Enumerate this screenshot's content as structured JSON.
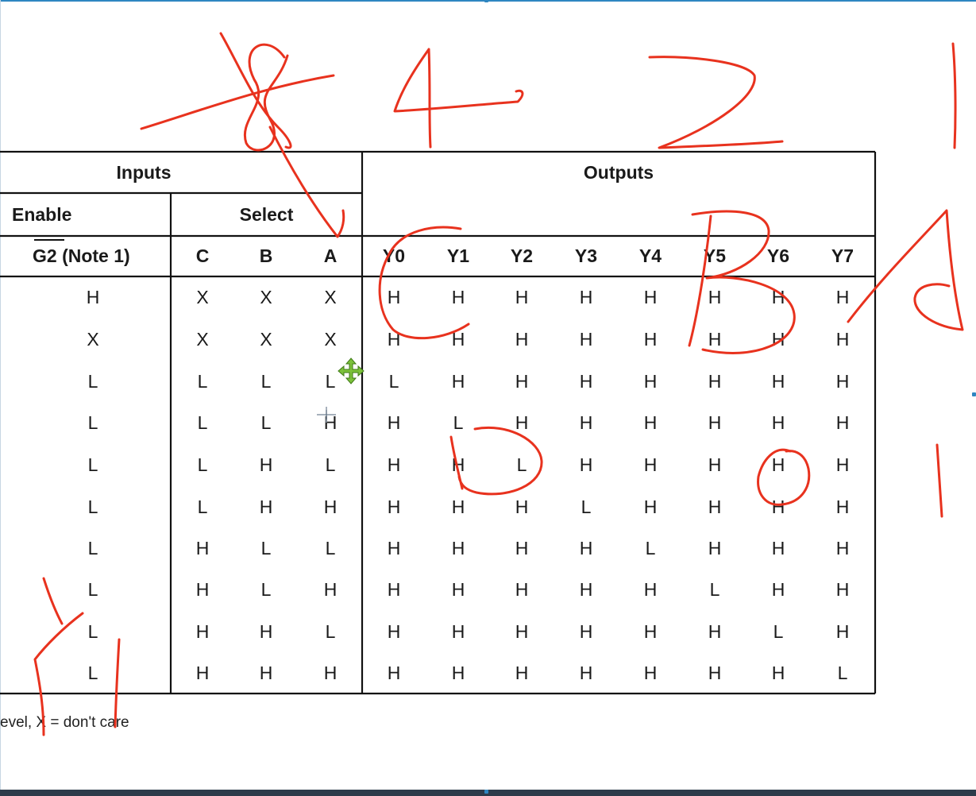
{
  "table": {
    "group_headers": {
      "inputs": "Inputs",
      "outputs": "Outputs"
    },
    "sub_headers": {
      "enable": "Enable",
      "select": "Select"
    },
    "column_headers": [
      {
        "label": "G2 (Note 1)",
        "overline": "G2"
      },
      {
        "label": "C"
      },
      {
        "label": "B"
      },
      {
        "label": "A"
      },
      {
        "label": "Y0"
      },
      {
        "label": "Y1"
      },
      {
        "label": "Y2"
      },
      {
        "label": "Y3"
      },
      {
        "label": "Y4"
      },
      {
        "label": "Y5"
      },
      {
        "label": "Y6"
      },
      {
        "label": "Y7"
      }
    ],
    "rows": [
      [
        "H",
        "X",
        "X",
        "X",
        "H",
        "H",
        "H",
        "H",
        "H",
        "H",
        "H",
        "H"
      ],
      [
        "X",
        "X",
        "X",
        "X",
        "H",
        "H",
        "H",
        "H",
        "H",
        "H",
        "H",
        "H"
      ],
      [
        "L",
        "L",
        "L",
        "L",
        "L",
        "H",
        "H",
        "H",
        "H",
        "H",
        "H",
        "H"
      ],
      [
        "L",
        "L",
        "L",
        "H",
        "H",
        "L",
        "H",
        "H",
        "H",
        "H",
        "H",
        "H"
      ],
      [
        "L",
        "L",
        "H",
        "L",
        "H",
        "H",
        "L",
        "H",
        "H",
        "H",
        "H",
        "H"
      ],
      [
        "L",
        "L",
        "H",
        "H",
        "H",
        "H",
        "H",
        "L",
        "H",
        "H",
        "H",
        "H"
      ],
      [
        "L",
        "H",
        "L",
        "L",
        "H",
        "H",
        "H",
        "H",
        "L",
        "H",
        "H",
        "H"
      ],
      [
        "L",
        "H",
        "L",
        "H",
        "H",
        "H",
        "H",
        "H",
        "H",
        "L",
        "H",
        "H"
      ],
      [
        "L",
        "H",
        "H",
        "L",
        "H",
        "H",
        "H",
        "H",
        "H",
        "H",
        "L",
        "H"
      ],
      [
        "L",
        "H",
        "H",
        "H",
        "H",
        "H",
        "H",
        "H",
        "H",
        "H",
        "H",
        "L"
      ]
    ]
  },
  "footnote": "evel, X = don't care",
  "annotation": {
    "color": "#e8321e",
    "description": "freehand red pen strokes drawn over the table",
    "marks": [
      "stroke-8",
      "stroke-4",
      "stroke-2",
      "stroke-1-top",
      "stroke-arrow-to-A",
      "stroke-C",
      "stroke-B",
      "stroke-D",
      "stroke-0",
      "stroke-1-right",
      "stroke-A",
      "stroke-y"
    ]
  },
  "cursors": [
    "move-cursor-icon",
    "crosshair-cursor-icon"
  ]
}
